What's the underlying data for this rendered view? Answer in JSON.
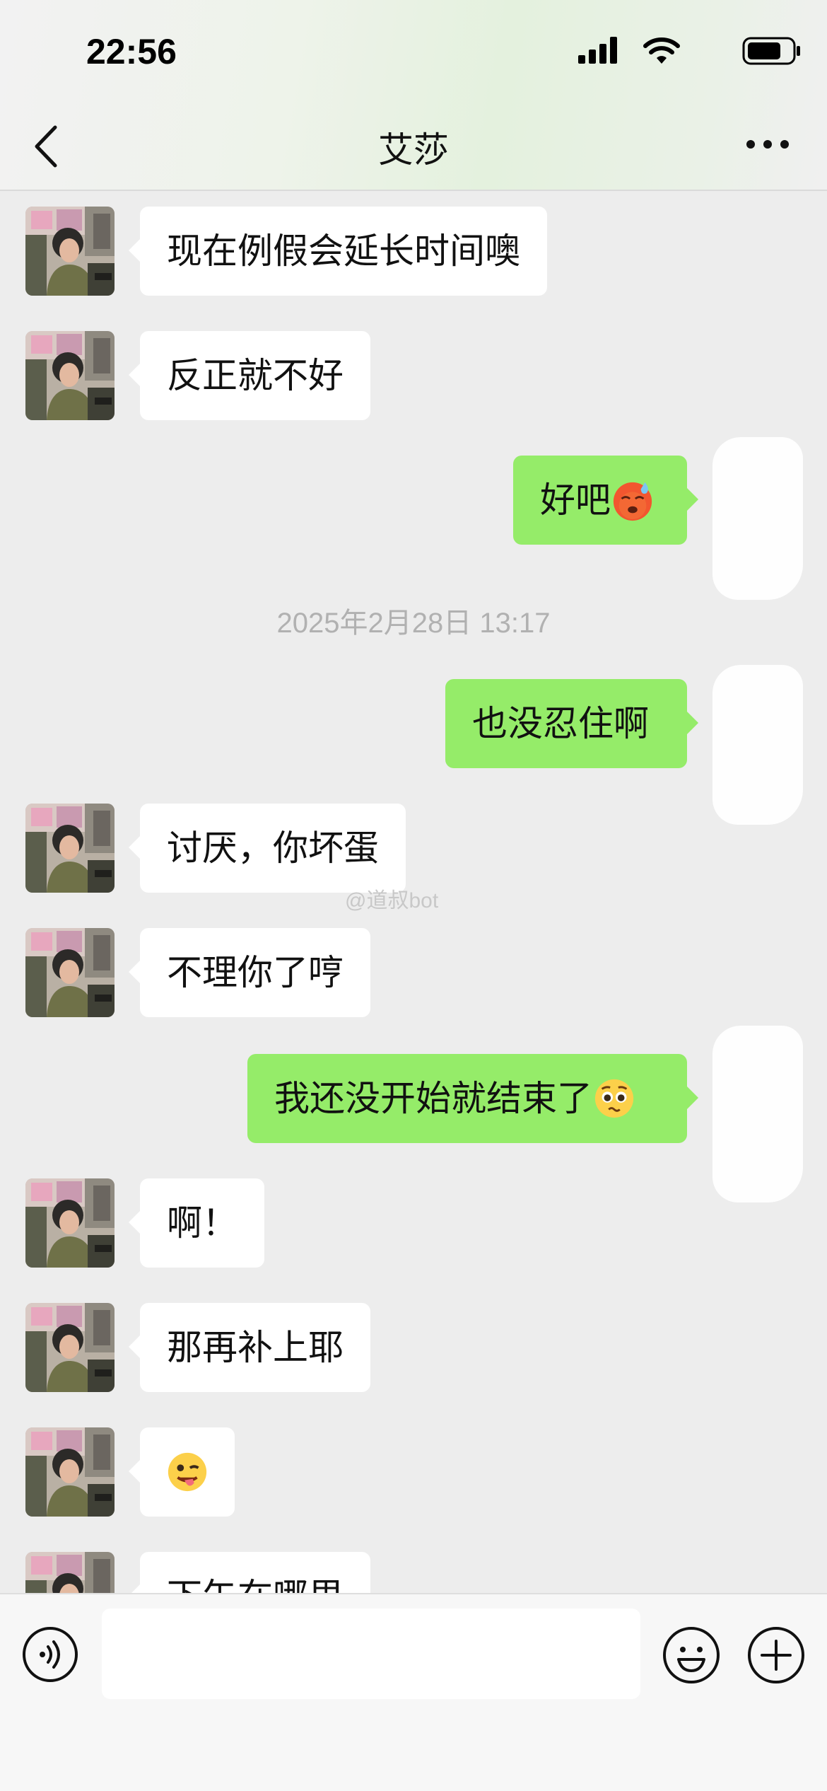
{
  "status_bar": {
    "time": "22:56"
  },
  "header": {
    "title": "艾莎"
  },
  "messages": [
    {
      "side": "in",
      "text": "现在例假会延长时间噢"
    },
    {
      "side": "in",
      "text": "反正就不好"
    },
    {
      "side": "out",
      "text": "好吧",
      "emoji": "hot-face-emoji"
    },
    {
      "type": "timestamp",
      "text": "2025年2月28日 13:17"
    },
    {
      "side": "out",
      "text": "也没忍住啊"
    },
    {
      "side": "in",
      "text": "讨厌，你坏蛋"
    },
    {
      "side": "in",
      "text": "不理你了哼"
    },
    {
      "side": "out",
      "text": "我还没开始就结束了",
      "emoji": "pleading-face-emoji"
    },
    {
      "side": "in",
      "text": "啊！"
    },
    {
      "side": "in",
      "text": "那再补上耶"
    },
    {
      "side": "in",
      "emoji": "winking-tongue-face-emoji"
    },
    {
      "side": "in",
      "text": "下午在哪里"
    }
  ],
  "watermark": "@道叔bot",
  "input_bar": {
    "value": ""
  },
  "colors": {
    "incoming_bubble": "#ffffff",
    "outgoing_bubble": "#95ec69",
    "background": "#ededed"
  },
  "icons": {
    "back": "chevron-left-icon",
    "more": "more-dots-icon",
    "voice": "voice-icon",
    "emoji": "emoji-icon",
    "plus": "plus-icon"
  }
}
